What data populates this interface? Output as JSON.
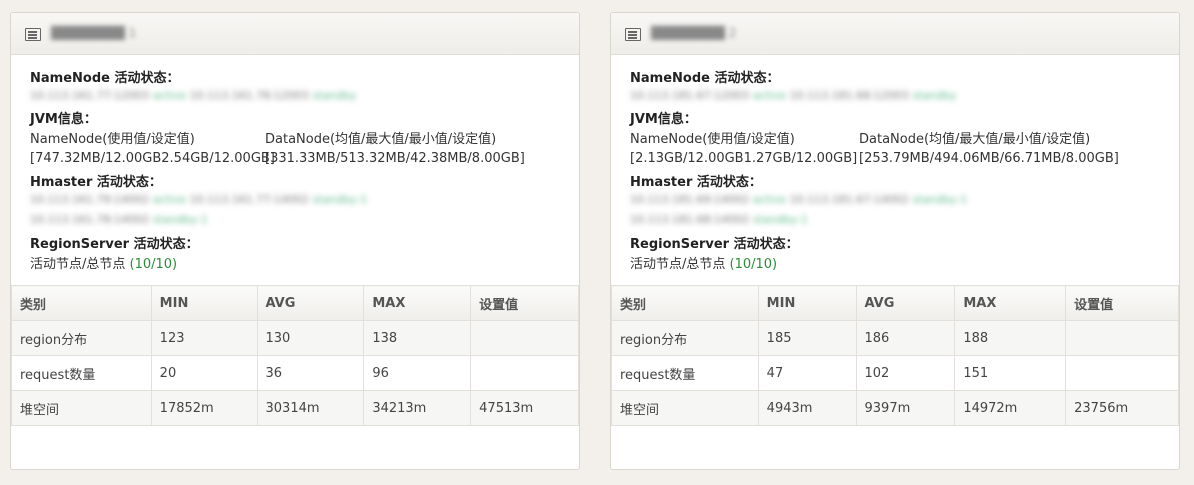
{
  "panels": [
    {
      "title": "████████ 1",
      "namenode_label": "NameNode 活动状态：",
      "namenode_hosts": {
        "a": "10.113.161.77:12003",
        "a_state": "active",
        "b": "10.113.161.78:12003",
        "b_state": "standby"
      },
      "jvm_label": "JVM信息：",
      "jvm_nn_header": "NameNode(使用值/设定值)",
      "jvm_dn_header": "DataNode(均值/最大值/最小值/设定值)",
      "jvm_nn_value": "[747.32MB/12.00GB2.54GB/12.00GB]",
      "jvm_dn_value": "[331.33MB/513.32MB/42.38MB/8.00GB]",
      "hmaster_label": "Hmaster 活动状态：",
      "hmaster_line1": {
        "a": "10.113.161.79:14002",
        "a_state": "active",
        "b": "10.113.161.77:14002",
        "b_state": "standby-1"
      },
      "hmaster_line2": {
        "a": "10.113.161.78:14002",
        "a_state": "standby-1"
      },
      "rs_label": "RegionServer 活动状态：",
      "rs_text": "活动节点/总节点 ",
      "rs_count": "(10/10)",
      "table": {
        "headers": [
          "类别",
          "MIN",
          "AVG",
          "MAX",
          "设置值"
        ],
        "rows": [
          [
            "region分布",
            "123",
            "130",
            "138",
            ""
          ],
          [
            "request数量",
            "20",
            "36",
            "96",
            ""
          ],
          [
            "堆空间",
            "17852m",
            "30314m",
            "34213m",
            "47513m"
          ]
        ]
      }
    },
    {
      "title": "████████ 2",
      "namenode_label": "NameNode 活动状态：",
      "namenode_hosts": {
        "a": "10.113.181.67:12003",
        "a_state": "active",
        "b": "10.113.181.68:12003",
        "b_state": "standby"
      },
      "jvm_label": "JVM信息：",
      "jvm_nn_header": "NameNode(使用值/设定值)",
      "jvm_dn_header": "DataNode(均值/最大值/最小值/设定值)",
      "jvm_nn_value": "[2.13GB/12.00GB1.27GB/12.00GB]",
      "jvm_dn_value": "[253.79MB/494.06MB/66.71MB/8.00GB]",
      "hmaster_label": "Hmaster 活动状态：",
      "hmaster_line1": {
        "a": "10.113.181.69:14002",
        "a_state": "active",
        "b": "10.113.181.67:14002",
        "b_state": "standby-1"
      },
      "hmaster_line2": {
        "a": "10.113.181.68:14002",
        "a_state": "standby-1"
      },
      "rs_label": "RegionServer 活动状态：",
      "rs_text": "活动节点/总节点 ",
      "rs_count": "(10/10)",
      "table": {
        "headers": [
          "类别",
          "MIN",
          "AVG",
          "MAX",
          "设置值"
        ],
        "rows": [
          [
            "region分布",
            "185",
            "186",
            "188",
            ""
          ],
          [
            "request数量",
            "47",
            "102",
            "151",
            ""
          ],
          [
            "堆空间",
            "4943m",
            "9397m",
            "14972m",
            "23756m"
          ]
        ]
      }
    }
  ]
}
